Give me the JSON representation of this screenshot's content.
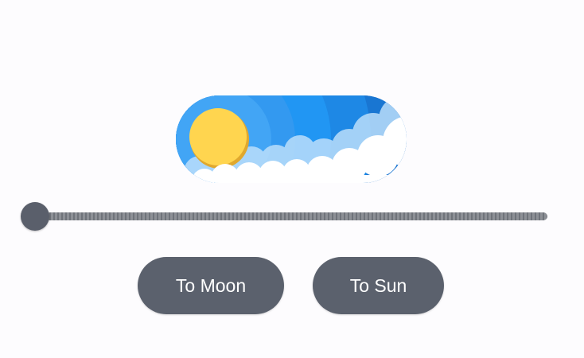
{
  "toggle": {
    "state": "day",
    "icon": "sun-cloud-toggle-icon",
    "colors": {
      "sky_light": "#42a5f5",
      "sky_dark": "#1565c0",
      "sun": "#ffd54f",
      "sun_edge": "#e0a82e",
      "cloud": "#ffffff",
      "cloud_back": "#bbdefb"
    }
  },
  "slider": {
    "value": 0.0,
    "thumb_color": "#5a5f6b"
  },
  "buttons": {
    "to_moon_label": "To Moon",
    "to_sun_label": "To Sun",
    "background": "#5b616d"
  }
}
